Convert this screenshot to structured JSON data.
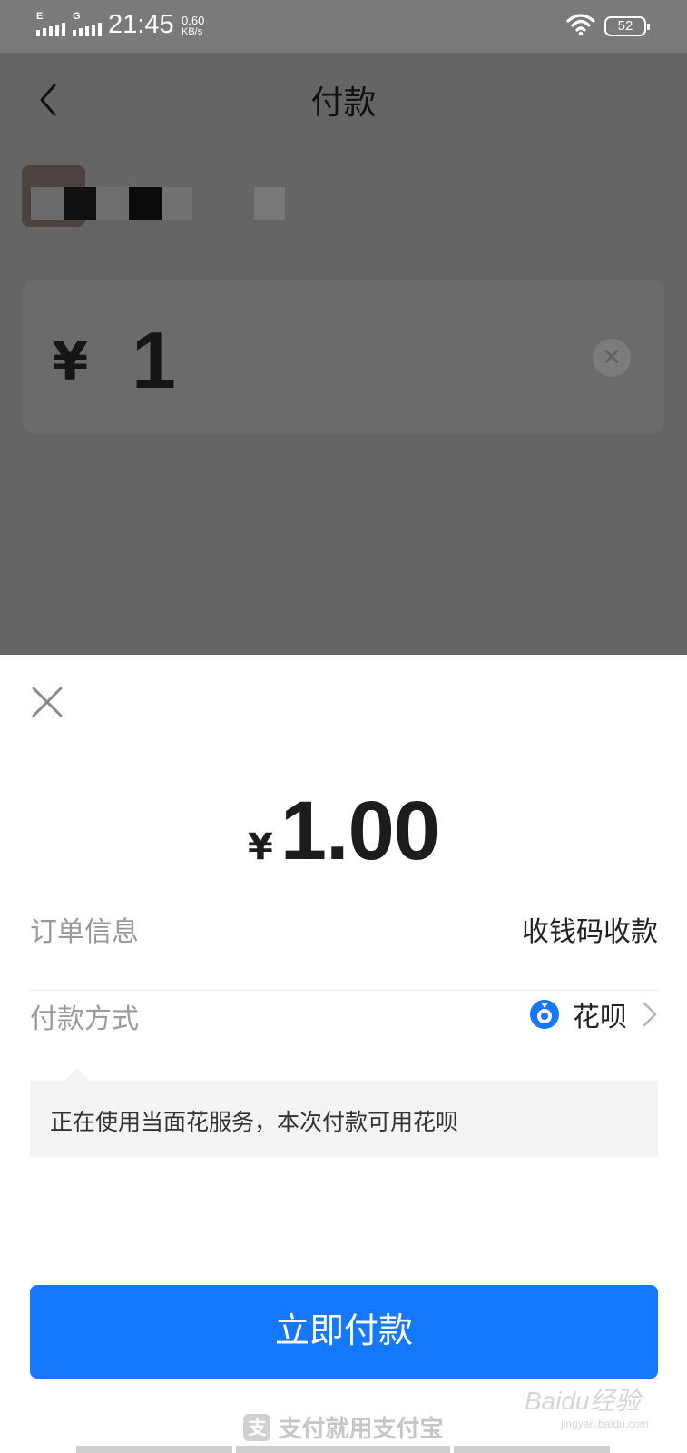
{
  "status_bar": {
    "network_1": "E",
    "network_2": "G",
    "time": "21:45",
    "speed_value": "0.60",
    "speed_unit": "KB/s",
    "battery": "52"
  },
  "page": {
    "title": "付款",
    "amount_currency": "¥",
    "amount_value": "1"
  },
  "sheet": {
    "currency_symbol": "¥",
    "amount": "1.00",
    "order_label": "订单信息",
    "order_value": "收钱码收款",
    "method_label": "付款方式",
    "method_value": "花呗",
    "notice": "正在使用当面花服务，本次付款可用花呗",
    "pay_button": "立即付款",
    "footer_slogan": "支付就用支付宝",
    "brand_color": "#1677ff"
  },
  "watermark": {
    "text": "Baidu经验",
    "sub": "jingyan.baidu.com"
  }
}
